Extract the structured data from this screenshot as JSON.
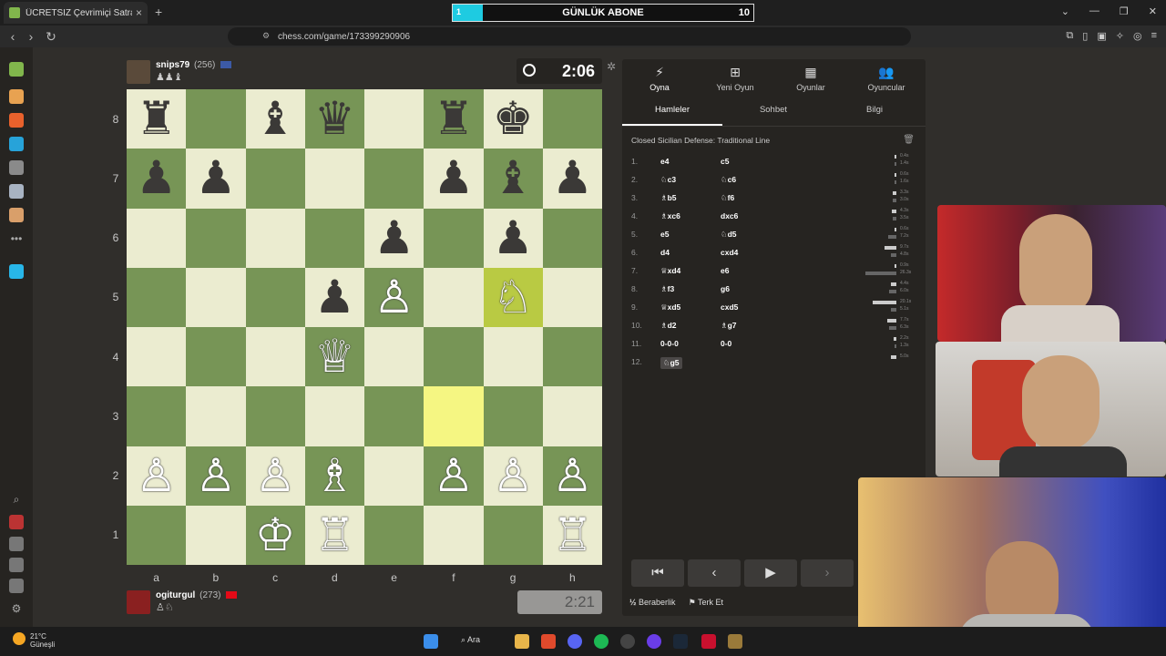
{
  "browser": {
    "tab_title": "ÜCRETSİZ Çevrimiçi Satranç Oyn",
    "tab_close": "×",
    "new_tab": "+",
    "url": "chess.com/game/173399290906",
    "back": "‹",
    "forward": "›",
    "reload": "↻"
  },
  "subscriber_goal": {
    "current": "1",
    "label": "GÜNLÜK ABONE",
    "goal": "10",
    "progress": 0.1,
    "color": "#1ecbe1"
  },
  "top_player": {
    "name": "snips79",
    "rating": "(256)",
    "captured": "♟♟♝",
    "clock": "2:06",
    "flag_color": "#3c5aa6"
  },
  "bottom_player": {
    "name": "ogiturgul",
    "rating": "(273)",
    "captured": "♙♘",
    "clock": "2:21",
    "flag_color": "#e30a17"
  },
  "board": {
    "files": [
      "a",
      "b",
      "c",
      "d",
      "e",
      "f",
      "g",
      "h"
    ],
    "ranks": [
      "8",
      "7",
      "6",
      "5",
      "4",
      "3",
      "2",
      "1"
    ],
    "last_move": [
      "g5",
      "f3"
    ],
    "colors": {
      "light": "#ebecd0",
      "dark": "#779556",
      "highlight_light": "#f5f682",
      "highlight_dark": "#b9ca43"
    },
    "pieces": [
      {
        "sq": "a8",
        "p": "♜",
        "c": "b"
      },
      {
        "sq": "c8",
        "p": "♝",
        "c": "b"
      },
      {
        "sq": "d8",
        "p": "♛",
        "c": "b"
      },
      {
        "sq": "f8",
        "p": "♜",
        "c": "b"
      },
      {
        "sq": "g8",
        "p": "♚",
        "c": "b"
      },
      {
        "sq": "a7",
        "p": "♟",
        "c": "b"
      },
      {
        "sq": "b7",
        "p": "♟",
        "c": "b"
      },
      {
        "sq": "f7",
        "p": "♟",
        "c": "b"
      },
      {
        "sq": "g7",
        "p": "♝",
        "c": "b"
      },
      {
        "sq": "h7",
        "p": "♟",
        "c": "b"
      },
      {
        "sq": "e6",
        "p": "♟",
        "c": "b"
      },
      {
        "sq": "g6",
        "p": "♟",
        "c": "b"
      },
      {
        "sq": "d5",
        "p": "♟",
        "c": "b"
      },
      {
        "sq": "e5",
        "p": "♙",
        "c": "w"
      },
      {
        "sq": "g5",
        "p": "♘",
        "c": "w"
      },
      {
        "sq": "d4",
        "p": "♕",
        "c": "w"
      },
      {
        "sq": "a2",
        "p": "♙",
        "c": "w"
      },
      {
        "sq": "b2",
        "p": "♙",
        "c": "w"
      },
      {
        "sq": "c2",
        "p": "♙",
        "c": "w"
      },
      {
        "sq": "d2",
        "p": "♗",
        "c": "w"
      },
      {
        "sq": "f2",
        "p": "♙",
        "c": "w"
      },
      {
        "sq": "g2",
        "p": "♙",
        "c": "w"
      },
      {
        "sq": "h2",
        "p": "♙",
        "c": "w"
      },
      {
        "sq": "c1",
        "p": "♔",
        "c": "w"
      },
      {
        "sq": "d1",
        "p": "♖",
        "c": "w"
      },
      {
        "sq": "h1",
        "p": "♖",
        "c": "w"
      }
    ]
  },
  "panel": {
    "top_tabs": [
      {
        "label": "Oyna",
        "icon": "⚡"
      },
      {
        "label": "Yeni Oyun",
        "icon": "⊞"
      },
      {
        "label": "Oyunlar",
        "icon": "▦"
      },
      {
        "label": "Oyuncular",
        "icon": "👥"
      }
    ],
    "sub_tabs": [
      "Hamleler",
      "Sohbet",
      "Bilgi"
    ],
    "opening": "Closed Sicilian Defense: Traditional Line",
    "moves": [
      {
        "n": "1.",
        "w": "e4",
        "b": "c5",
        "wt": "0.4s",
        "bt": "1.4s",
        "wf": 0.02,
        "bf": 0.05
      },
      {
        "n": "2.",
        "w": "♘c3",
        "b": "♘c6",
        "wt": "0.6s",
        "bt": "1.6s",
        "wf": 0.03,
        "bf": 0.06
      },
      {
        "n": "3.",
        "w": "♗b5",
        "b": "♘f6",
        "wt": "3.3s",
        "bt": "3.0s",
        "wf": 0.13,
        "bf": 0.11
      },
      {
        "n": "4.",
        "w": "♗xc6",
        "b": "dxc6",
        "wt": "4.3s",
        "bt": "3.5s",
        "wf": 0.16,
        "bf": 0.13
      },
      {
        "n": "5.",
        "w": "e5",
        "b": "♘d5",
        "wt": "0.6s",
        "bt": "7.2s",
        "wf": 0.03,
        "bf": 0.27
      },
      {
        "n": "6.",
        "w": "d4",
        "b": "cxd4",
        "wt": "9.7s",
        "bt": "4.8s",
        "wf": 0.37,
        "bf": 0.18
      },
      {
        "n": "7.",
        "w": "♕xd4",
        "b": "e6",
        "wt": "0.9s",
        "bt": "26.3s",
        "wf": 0.04,
        "bf": 1.0
      },
      {
        "n": "8.",
        "w": "♗f3",
        "b": "g6",
        "wt": "4.4s",
        "bt": "6.0s",
        "wf": 0.17,
        "bf": 0.23
      },
      {
        "n": "9.",
        "w": "♕xd5",
        "b": "cxd5",
        "wt": "20.1s",
        "bt": "5.1s",
        "wf": 0.76,
        "bf": 0.19
      },
      {
        "n": "10.",
        "w": "♗d2",
        "b": "♗g7",
        "wt": "7.7s",
        "bt": "6.3s",
        "wf": 0.29,
        "bf": 0.24
      },
      {
        "n": "11.",
        "w": "0-0-0",
        "b": "0-0",
        "wt": "2.2s",
        "bt": "1.3s",
        "wf": 0.08,
        "bf": 0.05
      },
      {
        "n": "12.",
        "w": "♘g5",
        "b": "",
        "wt": "5.0s",
        "bt": "",
        "wf": 0.19,
        "bf": 0
      }
    ],
    "controls": [
      "⏮",
      "‹",
      "▶",
      "›"
    ],
    "draw_label": "Beraberlik",
    "resign_label": "Terk Et",
    "draw_icon": "½",
    "resign_icon": "⚑"
  },
  "taskbar": {
    "temp": "21°C",
    "weather": "Güneşli",
    "search": "Ara"
  }
}
